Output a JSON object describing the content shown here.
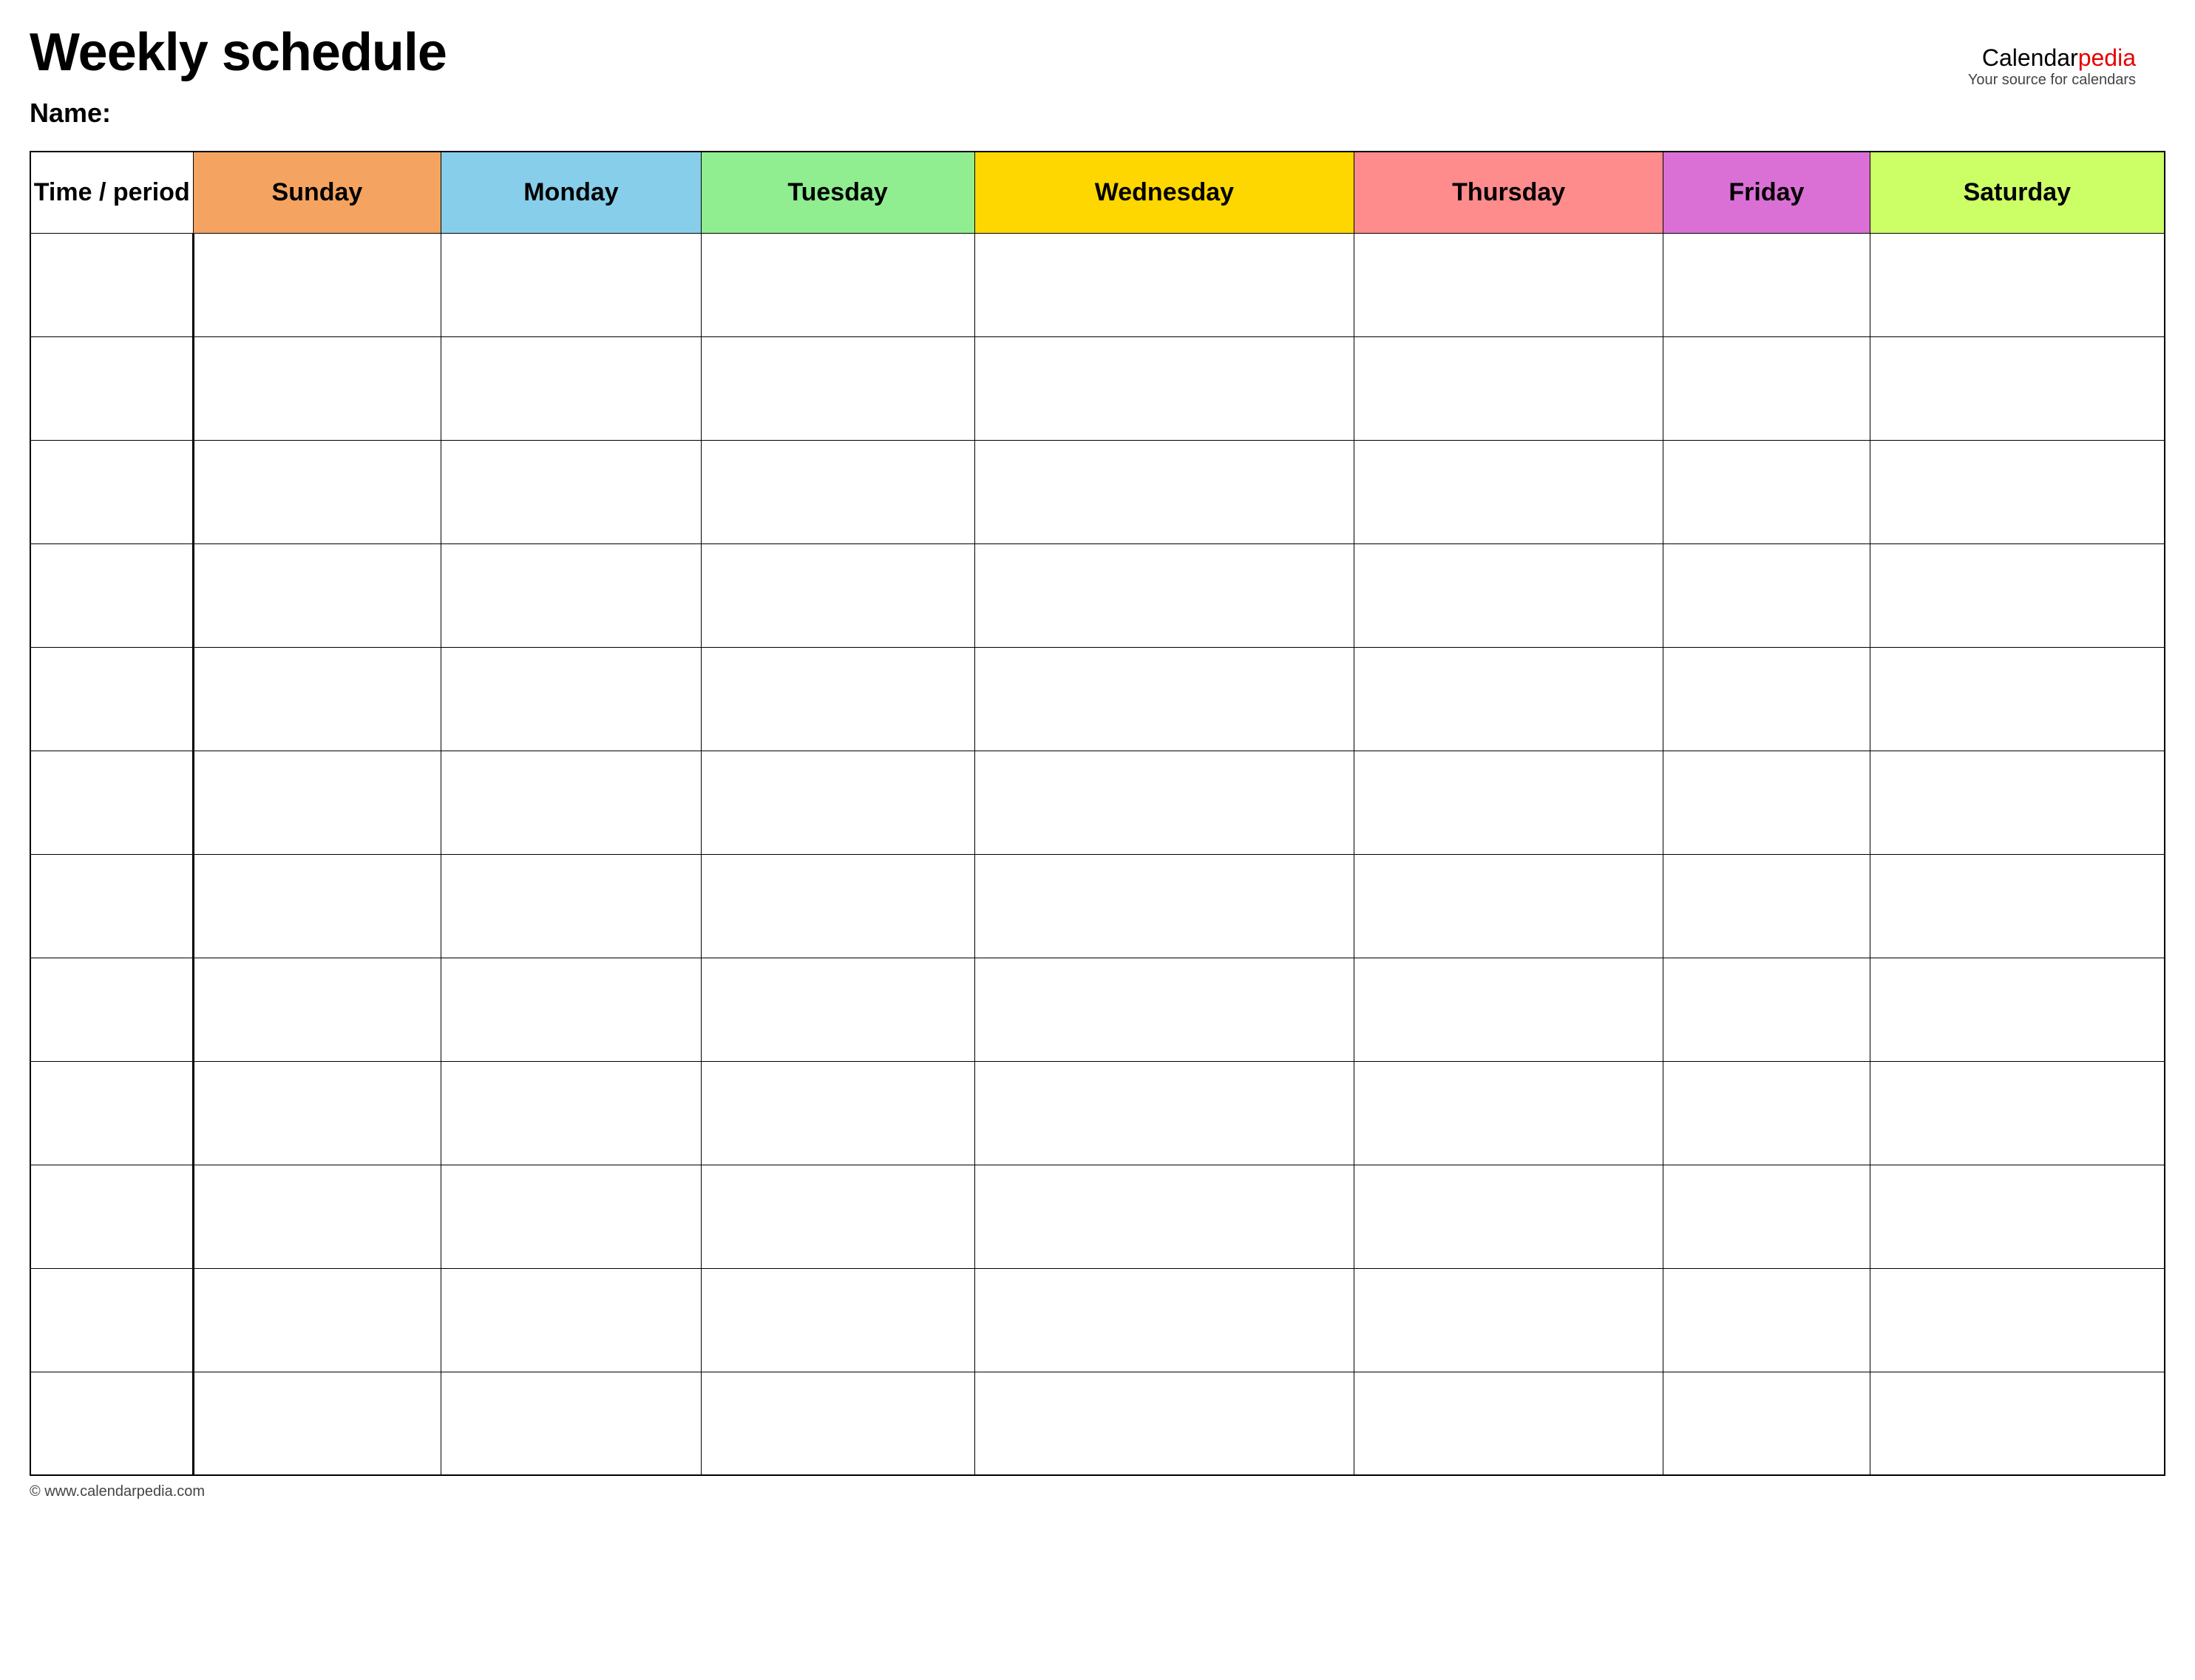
{
  "title": "Weekly schedule",
  "name_label": "Name:",
  "logo": {
    "brand_part1": "Calendar",
    "brand_part2": "pedia",
    "tagline": "Your source for calendars"
  },
  "columns": {
    "time_period": "Time / period",
    "sunday": "Sunday",
    "monday": "Monday",
    "tuesday": "Tuesday",
    "wednesday": "Wednesday",
    "thursday": "Thursday",
    "friday": "Friday",
    "saturday": "Saturday"
  },
  "footer": "© www.calendarpedia.com",
  "num_rows": 12
}
